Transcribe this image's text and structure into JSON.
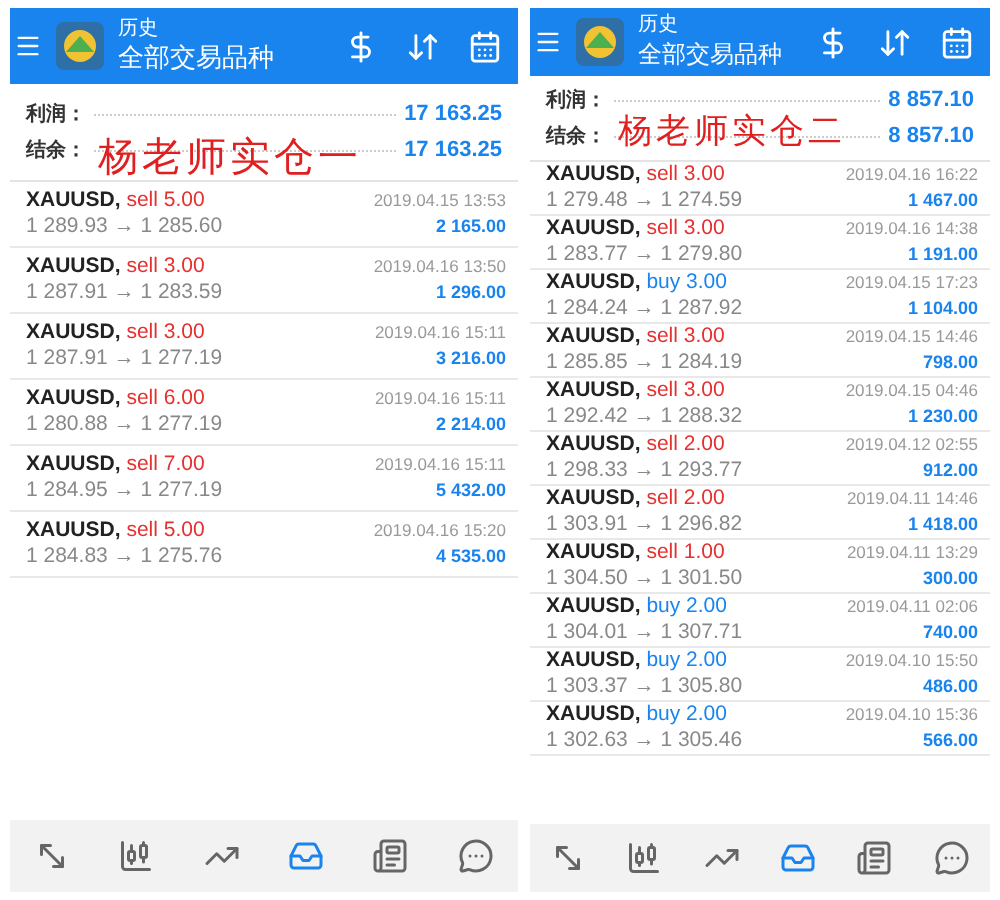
{
  "panels": [
    {
      "header": {
        "title": "历史",
        "subtitle": "全部交易品种"
      },
      "summary": [
        {
          "label": "利润：",
          "value": "17 163.25"
        },
        {
          "label": "结余：",
          "value": "17 163.25"
        }
      ],
      "annotation": "杨老师实仓一",
      "trades": [
        {
          "symbol": "XAUUSD,",
          "kind": "sell",
          "side": "sell 5.00",
          "prices": "1 289.93 → 1 285.60",
          "time": "2019.04.15 13:53",
          "profit": "2 165.00"
        },
        {
          "symbol": "XAUUSD,",
          "kind": "sell",
          "side": "sell 3.00",
          "prices": "1 287.91 → 1 283.59",
          "time": "2019.04.16 13:50",
          "profit": "1 296.00"
        },
        {
          "symbol": "XAUUSD,",
          "kind": "sell",
          "side": "sell 3.00",
          "prices": "1 287.91 → 1 277.19",
          "time": "2019.04.16 15:11",
          "profit": "3 216.00"
        },
        {
          "symbol": "XAUUSD,",
          "kind": "sell",
          "side": "sell 6.00",
          "prices": "1 280.88 → 1 277.19",
          "time": "2019.04.16 15:11",
          "profit": "2 214.00"
        },
        {
          "symbol": "XAUUSD,",
          "kind": "sell",
          "side": "sell 7.00",
          "prices": "1 284.95 → 1 277.19",
          "time": "2019.04.16 15:11",
          "profit": "5 432.00"
        },
        {
          "symbol": "XAUUSD,",
          "kind": "sell",
          "side": "sell 5.00",
          "prices": "1 284.83 → 1 275.76",
          "time": "2019.04.16 15:20",
          "profit": "4 535.00"
        }
      ],
      "nav": [
        {
          "kind": "trade",
          "selected": false
        },
        {
          "kind": "chart",
          "selected": false
        },
        {
          "kind": "trend",
          "selected": false
        },
        {
          "kind": "inbox",
          "selected": true
        },
        {
          "kind": "news",
          "selected": false
        },
        {
          "kind": "chat",
          "selected": false
        }
      ]
    },
    {
      "header": {
        "title": "历史",
        "subtitle": "全部交易品种"
      },
      "summary": [
        {
          "label": "利润：",
          "value": "8 857.10"
        },
        {
          "label": "结余：",
          "value": "8 857.10"
        }
      ],
      "annotation": "杨老师实仓二",
      "trades": [
        {
          "symbol": "XAUUSD,",
          "kind": "sell",
          "side": "sell 3.00",
          "prices": "1 279.48 → 1 274.59",
          "time": "2019.04.16 16:22",
          "profit": "1 467.00"
        },
        {
          "symbol": "XAUUSD,",
          "kind": "sell",
          "side": "sell 3.00",
          "prices": "1 283.77 → 1 279.80",
          "time": "2019.04.16 14:38",
          "profit": "1 191.00"
        },
        {
          "symbol": "XAUUSD,",
          "kind": "buy",
          "side": "buy 3.00",
          "prices": "1 284.24 → 1 287.92",
          "time": "2019.04.15 17:23",
          "profit": "1 104.00"
        },
        {
          "symbol": "XAUUSD,",
          "kind": "sell",
          "side": "sell 3.00",
          "prices": "1 285.85 → 1 284.19",
          "time": "2019.04.15 14:46",
          "profit": "798.00"
        },
        {
          "symbol": "XAUUSD,",
          "kind": "sell",
          "side": "sell 3.00",
          "prices": "1 292.42 → 1 288.32",
          "time": "2019.04.15 04:46",
          "profit": "1 230.00"
        },
        {
          "symbol": "XAUUSD,",
          "kind": "sell",
          "side": "sell 2.00",
          "prices": "1 298.33 → 1 293.77",
          "time": "2019.04.12 02:55",
          "profit": "912.00"
        },
        {
          "symbol": "XAUUSD,",
          "kind": "sell",
          "side": "sell 2.00",
          "prices": "1 303.91 → 1 296.82",
          "time": "2019.04.11 14:46",
          "profit": "1 418.00"
        },
        {
          "symbol": "XAUUSD,",
          "kind": "sell",
          "side": "sell 1.00",
          "prices": "1 304.50 → 1 301.50",
          "time": "2019.04.11 13:29",
          "profit": "300.00"
        },
        {
          "symbol": "XAUUSD,",
          "kind": "buy",
          "side": "buy 2.00",
          "prices": "1 304.01 → 1 307.71",
          "time": "2019.04.11 02:06",
          "profit": "740.00"
        },
        {
          "symbol": "XAUUSD,",
          "kind": "buy",
          "side": "buy 2.00",
          "prices": "1 303.37 → 1 305.80",
          "time": "2019.04.10 15:50",
          "profit": "486.00"
        },
        {
          "symbol": "XAUUSD,",
          "kind": "buy",
          "side": "buy 2.00",
          "prices": "1 302.63 → 1 305.46",
          "time": "2019.04.10 15:36",
          "profit": "566.00"
        }
      ],
      "nav": [
        {
          "kind": "trade",
          "selected": false
        },
        {
          "kind": "chart",
          "selected": false
        },
        {
          "kind": "trend",
          "selected": false
        },
        {
          "kind": "inbox",
          "selected": true
        },
        {
          "kind": "news",
          "selected": false
        },
        {
          "kind": "chat",
          "selected": false
        }
      ]
    }
  ]
}
